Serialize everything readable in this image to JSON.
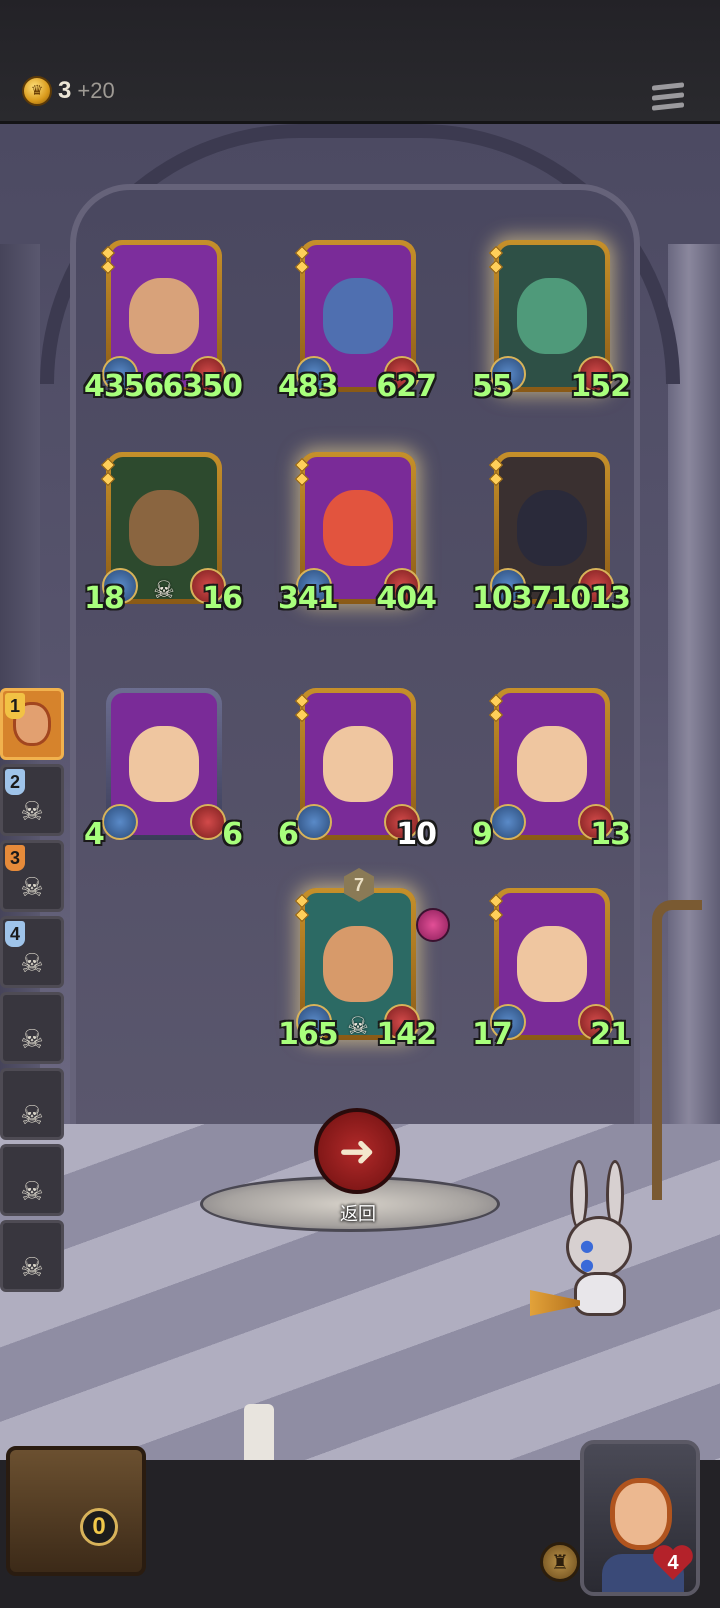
{
  "header": {
    "gold_value": "3",
    "gold_increment": "+20",
    "menu_icon": "hamburger-icon"
  },
  "board": {
    "rows": [
      [
        {
          "atk": "4356",
          "hp": "6350",
          "glow": false,
          "portrait_color": "#7d2e9d",
          "face_color": "#d8a27a",
          "tribe_icon": "leaf-hair-creature"
        },
        {
          "atk": "483",
          "hp": "627",
          "glow": false,
          "portrait_color": "#7a2b98",
          "face_color": "#4f6fb0",
          "tribe_icon": "blue-imp"
        },
        {
          "atk": "55",
          "hp": "152",
          "glow": true,
          "portrait_color": "#2e5046",
          "face_color": "#4f9a7a",
          "tribe_icon": "frog-noble"
        }
      ],
      [
        {
          "atk": "18",
          "hp": "16",
          "glow": false,
          "portrait_color": "#2d4a2e",
          "face_color": "#8a6540",
          "tribe_icon": "scarecrow",
          "deathrattle": true
        },
        {
          "atk": "341",
          "hp": "404",
          "glow": true,
          "portrait_color": "#7a2b98",
          "face_color": "#e2543e",
          "tribe_icon": "red-blob"
        },
        {
          "atk": "1037",
          "hp": "1013",
          "glow": false,
          "portrait_color": "#3a3030",
          "face_color": "#2a2a3a",
          "tribe_icon": "top-hat-gentleman"
        }
      ],
      [
        {
          "atk": "4",
          "hp": "6",
          "glow": false,
          "blue_frame": true,
          "portrait_color": "#7a2b98",
          "face_color": "#efc6a0",
          "tribe_icon": "girl-with-doll"
        },
        {
          "atk": "6",
          "hp": "10",
          "glow": false,
          "hp_white": true,
          "portrait_color": "#7a2b98",
          "face_color": "#efc6a0",
          "tribe_icon": "girl-with-doll"
        },
        {
          "atk": "9",
          "hp": "13",
          "glow": false,
          "portrait_color": "#7a2b98",
          "face_color": "#efc6a0",
          "tribe_icon": "girl-with-doll"
        }
      ],
      [
        {
          "atk": "165",
          "hp": "142",
          "glow": true,
          "level": "7",
          "portrait_color": "#2c6a64",
          "face_color": "#d79a6a",
          "tribe_icon": "knight",
          "deathrattle": true,
          "item_icon": "pig-charm-icon"
        },
        {
          "atk": "17",
          "hp": "21",
          "glow": false,
          "portrait_color": "#7a2b98",
          "face_color": "#efc6a0",
          "tribe_icon": "girl-with-doll"
        }
      ]
    ]
  },
  "sidebar": {
    "slots": [
      {
        "num": "1",
        "badge_color": "gold",
        "active": true
      },
      {
        "num": "2",
        "badge_color": "blue",
        "active": false
      },
      {
        "num": "3",
        "badge_color": "orange",
        "active": false
      },
      {
        "num": "4",
        "badge_color": "blue",
        "active": false
      },
      {
        "num": "",
        "active": false
      },
      {
        "num": "",
        "active": false
      },
      {
        "num": "",
        "active": false
      },
      {
        "num": "",
        "active": false
      }
    ]
  },
  "back_button": {
    "label": "返回",
    "icon": "arrow-left-icon"
  },
  "footer": {
    "chest_count": "0",
    "hero_life": "4",
    "bell_icon": "bell-icon"
  },
  "colors": {
    "stat_green": "#a8ff7c",
    "back_red": "#b22a2a",
    "gold_accent": "#d8b35a"
  }
}
